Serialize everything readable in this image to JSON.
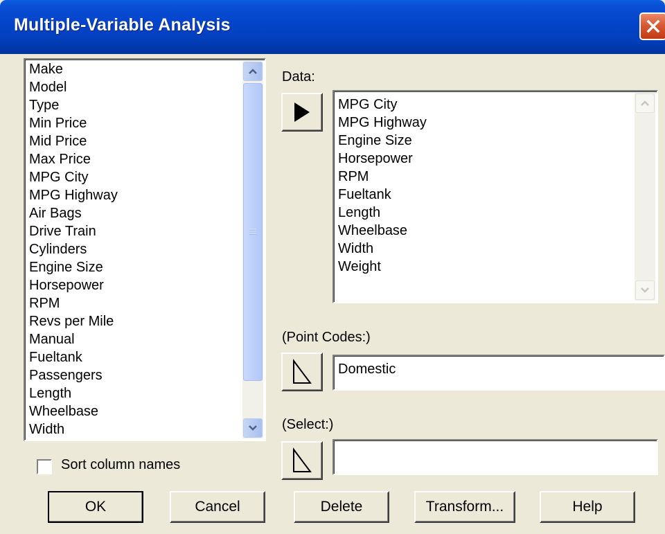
{
  "window": {
    "title": "Multiple-Variable Analysis",
    "close_icon": "close-icon",
    "close_color": "#D85A35"
  },
  "variables": {
    "items": [
      "Make",
      "Model",
      "Type",
      "Min Price",
      "Mid Price",
      "Max Price",
      "MPG City",
      "MPG Highway",
      "Air Bags",
      "Drive Train",
      "Cylinders",
      "Engine Size",
      "Horsepower",
      "RPM",
      "Revs per Mile",
      "Manual",
      "Fueltank",
      "Passengers",
      "Length",
      "Wheelbase",
      "Width"
    ]
  },
  "data_field": {
    "label": "Data:",
    "items": [
      "MPG City",
      "MPG Highway",
      "Engine Size",
      "Horsepower",
      "RPM",
      "Fueltank",
      "Length",
      "Wheelbase",
      "Width",
      "Weight"
    ]
  },
  "point_codes": {
    "label": "(Point Codes:)",
    "value": "Domestic"
  },
  "select_field": {
    "label": "(Select:)",
    "value": ""
  },
  "sort": {
    "label": "Sort column names",
    "checked": false
  },
  "buttons": {
    "ok": "OK",
    "cancel": "Cancel",
    "delete": "Delete",
    "transform": "Transform...",
    "help": "Help"
  }
}
